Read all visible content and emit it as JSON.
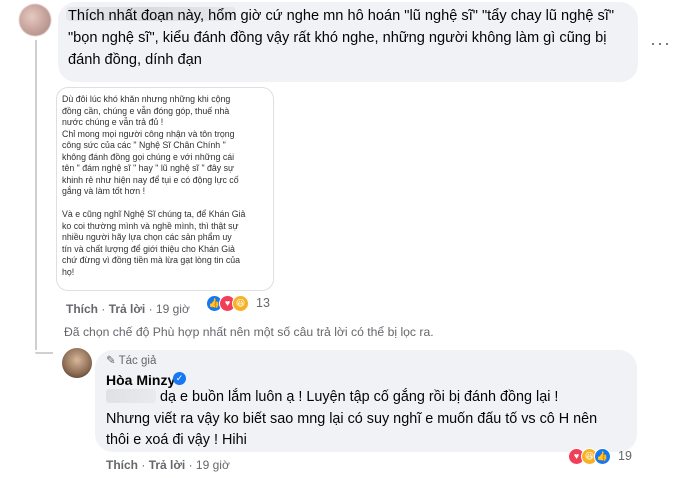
{
  "comment1": {
    "text": "Thích nhất đoạn này, hổm giờ cứ nghe mn hô hoán \"lũ nghệ sĩ\" \"tẩy chay lũ nghệ sĩ\" \"bọn nghệ sĩ\", kiểu đánh đồng vậy rất khó nghe, những người không làm gì cũng bị đánh đồng, dính đạn",
    "more_icon": "more-horizontal-icon",
    "image_text": "Dù đôi lúc khó khăn nhưng những khi cộng\nđồng cần, chúng e vẫn đóng góp, thuế nhà\nnước chúng e vẫn trả đủ !\nChỉ mong mọi người công nhận và tôn trọng\ncông sức của các \" Nghệ Sĩ Chân Chính \"\nkhông đánh đồng gọi chúng e với những cái\ntên \" đám nghệ sĩ \" hay \" lũ nghệ sĩ \" đây sự\nkhinh rẻ như hiện nay để tụi e có động lực cố\ngắng và làm tốt hơn !\n\nVà e cũng nghĩ Nghệ Sĩ chúng ta, để Khán Giả\nko coi thường mình và nghề mình, thì thật sự\nnhiều người hãy lựa chọn các sản phẩm uy\ntín và chất lượng để giới thiệu cho Khán Giả\nchứ đừng vì đồng tiền mà lừa gạt lòng tin của\nhọ!",
    "reaction_count": "13",
    "like_label": "Thích",
    "reply_label": "Trả lời",
    "time": "19 giờ"
  },
  "filter_note": "Đã chọn chế độ Phù hợp nhất nên một số câu trả lời có thể bị lọc ra.",
  "reply": {
    "badge": "Tác giả",
    "author": "Hòa Minzy",
    "line1": "dạ e buồn lắm luôn ạ ! Luyện tập cố gắng rồi bị đánh đồng lại !",
    "line2": "Nhưng viết ra vậy ko biết sao mng lại có suy nghĩ e muốn đấu tố vs cô H nên",
    "line3": "thôi e xoá đi vậy ! Hihi",
    "like_label": "Thích",
    "reply_label": "Trả lời",
    "time": "19 giờ",
    "reaction_count": "19"
  },
  "colors": {
    "like": "#1877f2",
    "love": "#f33e58",
    "haha": "#f7b125",
    "bubble": "#f0f2f5"
  }
}
